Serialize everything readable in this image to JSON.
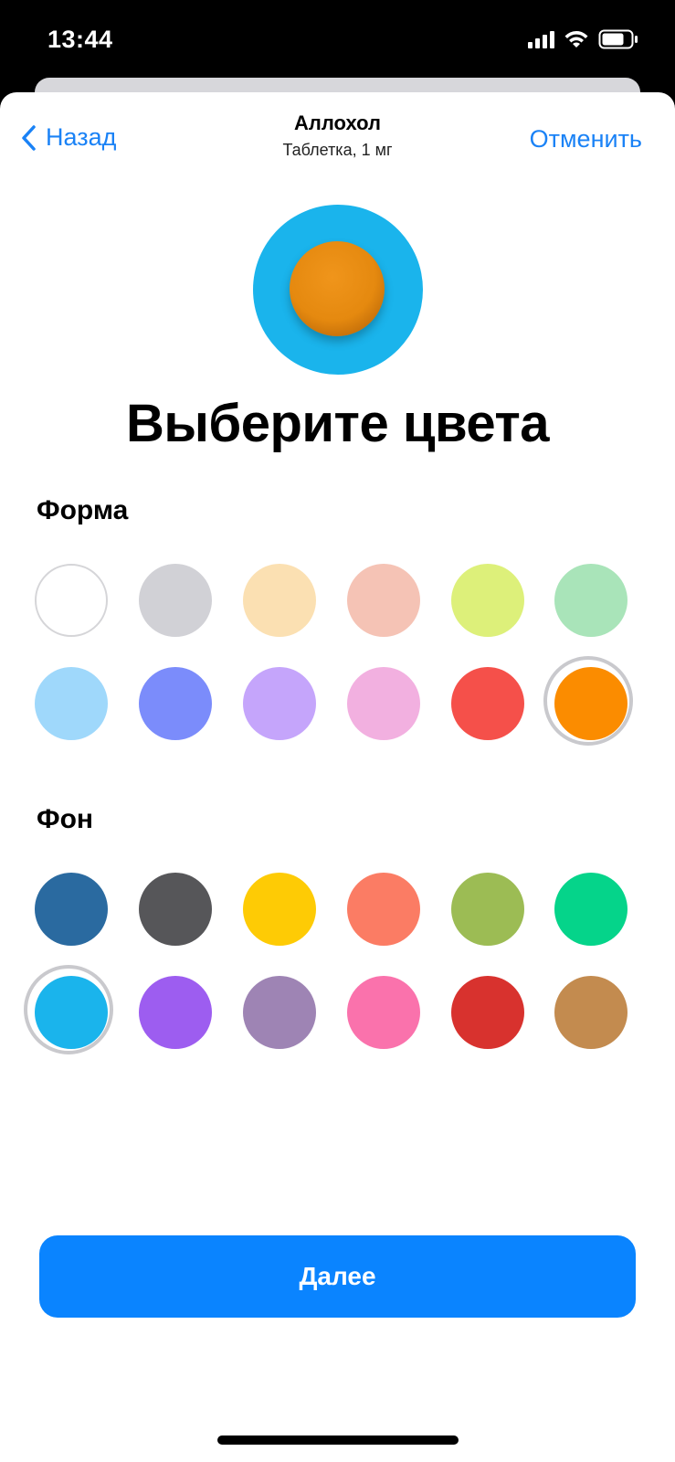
{
  "status_bar": {
    "time": "13:44"
  },
  "nav": {
    "back_label": "Назад",
    "title": "Аллохол",
    "subtitle": "Таблетка, 1 мг",
    "cancel_label": "Отменить"
  },
  "hero": {
    "background_color": "#1ab4ec",
    "pill_color": "#e5890f"
  },
  "page_title": "Выберите цвета",
  "shape_section": {
    "title": "Форма",
    "colors": [
      [
        "#ffffff",
        "#d1d1d6",
        "#fbe0b2",
        "#f5c3b5",
        "#ddf07a",
        "#a9e4b9"
      ],
      [
        "#9fd8fb",
        "#7b8cfb",
        "#c5a5fb",
        "#f2b0e0",
        "#f5504a",
        "#fb8c00"
      ]
    ],
    "selected_index": 11
  },
  "background_section": {
    "title": "Фон",
    "colors": [
      [
        "#2a6aa0",
        "#565659",
        "#fecb05",
        "#fb7c64",
        "#9cbc54",
        "#05d48a"
      ],
      [
        "#1ab4ec",
        "#9d5df0",
        "#9e84b4",
        "#fa72ac",
        "#d8322e",
        "#c38b4f"
      ]
    ],
    "selected_index": 6
  },
  "next_button_label": "Далее"
}
